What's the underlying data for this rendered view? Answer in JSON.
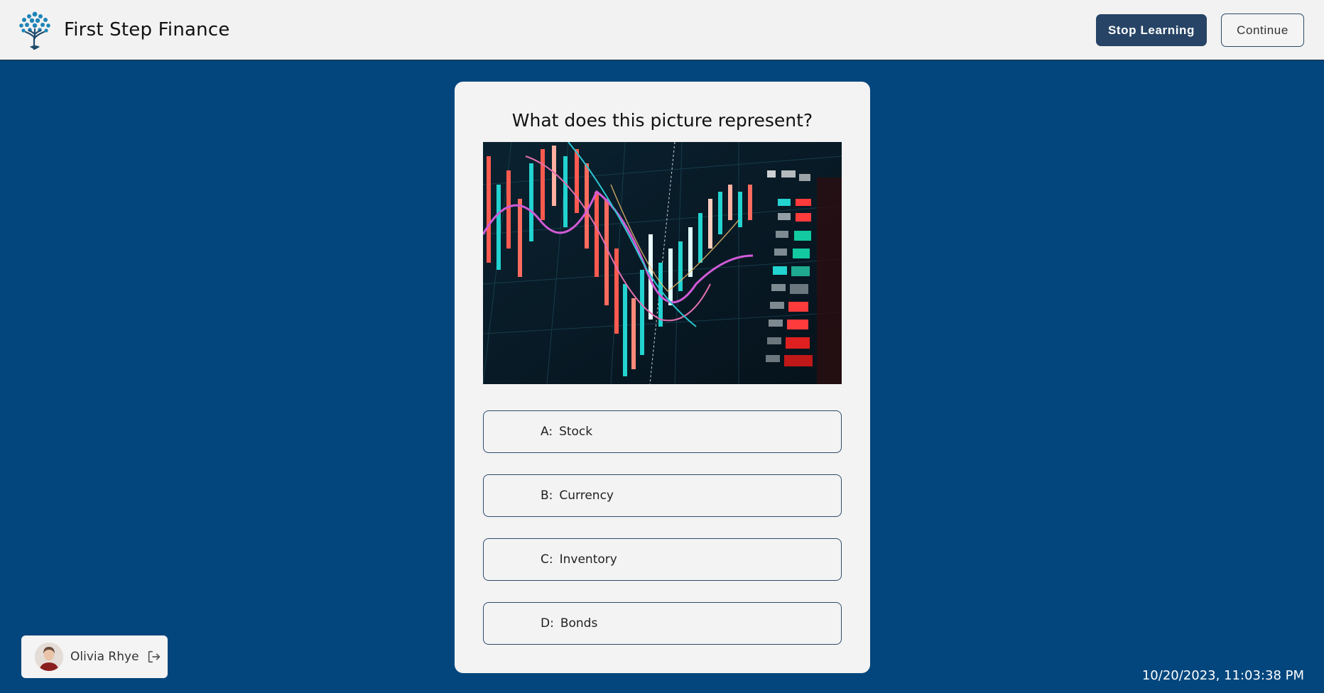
{
  "header": {
    "app_name": "First Step Finance",
    "logo_icon": "tree-icon",
    "stop_label": "Stop Learning",
    "continue_label": "Continue"
  },
  "quiz": {
    "question": "What does this picture represent?",
    "image_icon": "stock-chart-photo",
    "options": [
      {
        "letter": "A:",
        "text": "Stock"
      },
      {
        "letter": "B:",
        "text": "Currency"
      },
      {
        "letter": "C:",
        "text": "Inventory"
      },
      {
        "letter": "D:",
        "text": "Bonds"
      }
    ]
  },
  "user": {
    "name": "Olivia Rhye",
    "logout_icon": "logout-icon"
  },
  "timestamp": "10/20/2023, 11:03:38 PM",
  "colors": {
    "background": "#03467d",
    "header": "#f2f2f2",
    "primary_button": "#274466",
    "card": "#f3f3f3",
    "logo": "#1e7fb0"
  }
}
